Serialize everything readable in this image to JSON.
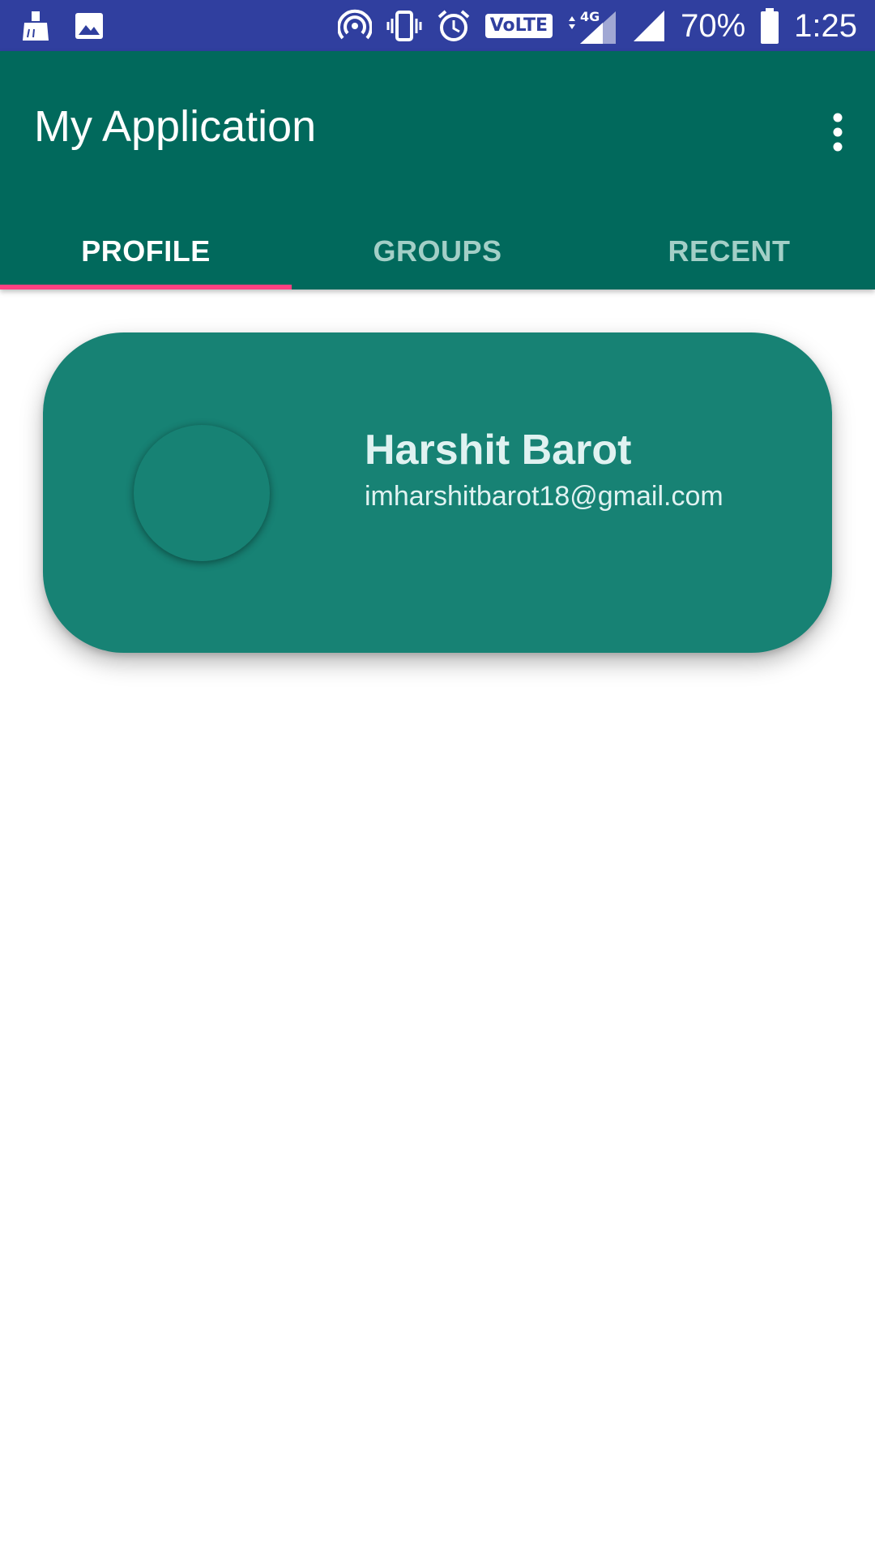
{
  "status_bar": {
    "battery_percent": "70%",
    "time": "1:25",
    "volte_label": "VoLTE",
    "network_label": "4G",
    "icons": [
      "cleaner-icon",
      "image-icon",
      "hotspot-icon",
      "vibrate-icon",
      "alarm-icon",
      "volte-icon",
      "signal-4g-icon",
      "signal-icon",
      "battery-icon"
    ]
  },
  "app_bar": {
    "title": "My Application",
    "overflow_icon": "more-vert-icon"
  },
  "tabs": [
    {
      "label": "PROFILE",
      "active": true
    },
    {
      "label": "GROUPS",
      "active": false
    },
    {
      "label": "RECENT",
      "active": false
    }
  ],
  "profile": {
    "name": "Harshit Barot",
    "email": "imharshitbarot18@gmail.com"
  },
  "colors": {
    "status_bar": "#303f9f",
    "app_bar": "#01695c",
    "card": "#178274",
    "tab_indicator": "#ff4081",
    "inactive_tab_text": "#a3cfc7"
  }
}
